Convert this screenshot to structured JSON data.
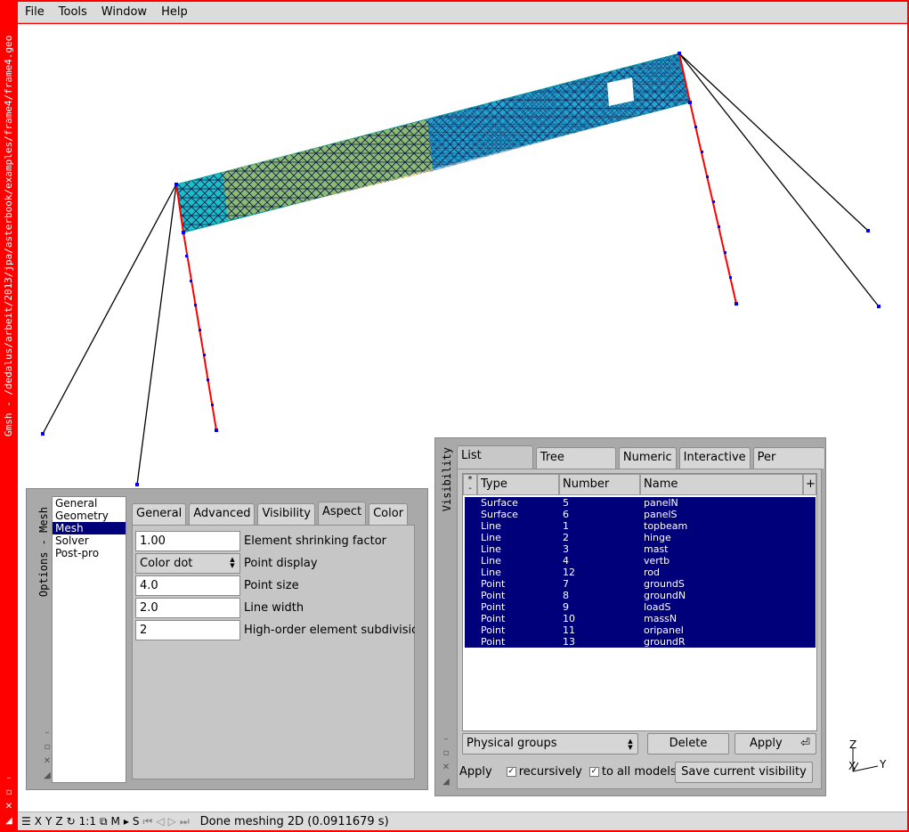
{
  "window": {
    "title": "Gmsh - /dedalus/arbeit/2013/jpa/asterbook/examples/frame4/frame4.geo"
  },
  "menubar": {
    "items": [
      "File",
      "Tools",
      "Window",
      "Help"
    ]
  },
  "options": {
    "side_title": "Options - Mesh",
    "categories": [
      "General",
      "Geometry",
      "Mesh",
      "Solver",
      "Post-pro"
    ],
    "selected_category": "Mesh",
    "tabs": [
      "General",
      "Advanced",
      "Visibility",
      "Aspect",
      "Color"
    ],
    "active_tab": "Aspect",
    "fields": {
      "shrink": {
        "value": "1.00",
        "label": "Element shrinking factor"
      },
      "point_display": {
        "value": "Color dot",
        "label": "Point display"
      },
      "point_size": {
        "value": "4.0",
        "label": "Point size"
      },
      "line_width": {
        "value": "2.0",
        "label": "Line width"
      },
      "ho_subdiv": {
        "value": "2",
        "label": "High-order element subdivisions"
      }
    }
  },
  "visibility": {
    "side_title": "Visibility",
    "tabs": [
      "List browser",
      "Tree browser",
      "Numeric",
      "Interactive",
      "Per window"
    ],
    "active_tab": "List browser",
    "columns": {
      "type": "Type",
      "number": "Number",
      "name": "Name",
      "plus": "+",
      "star": "*",
      "minus": "-"
    },
    "rows": [
      {
        "type": "Surface",
        "number": "5",
        "name": "panelN"
      },
      {
        "type": "Surface",
        "number": "6",
        "name": "panelS"
      },
      {
        "type": "Line",
        "number": "1",
        "name": "topbeam"
      },
      {
        "type": "Line",
        "number": "2",
        "name": "hinge"
      },
      {
        "type": "Line",
        "number": "3",
        "name": "mast"
      },
      {
        "type": "Line",
        "number": "4",
        "name": "vertb"
      },
      {
        "type": "Line",
        "number": "12",
        "name": "rod"
      },
      {
        "type": "Point",
        "number": "7",
        "name": "groundS"
      },
      {
        "type": "Point",
        "number": "8",
        "name": "groundN"
      },
      {
        "type": "Point",
        "number": "9",
        "name": "loadS"
      },
      {
        "type": "Point",
        "number": "10",
        "name": "massN"
      },
      {
        "type": "Point",
        "number": "11",
        "name": "oripanel"
      },
      {
        "type": "Point",
        "number": "13",
        "name": "groundR"
      }
    ],
    "mode_select": "Physical groups",
    "delete_label": "Delete",
    "apply_label": "Apply",
    "apply_text": "Apply",
    "recursively_label": "recursively",
    "all_models_label": "to all models",
    "save_label": "Save current visibility"
  },
  "statusbar": {
    "x": "X",
    "y": "Y",
    "z": "Z",
    "ratio": "1:1",
    "m": "M",
    "s": "S",
    "message": "Done meshing 2D (0.0911679 s)"
  },
  "axes": {
    "z": "Z",
    "x": "X",
    "y": "Y"
  },
  "colors": {
    "frame": "#ff0000",
    "selection": "#00007a",
    "rod": "#ff0000",
    "node": "#0000ff"
  }
}
